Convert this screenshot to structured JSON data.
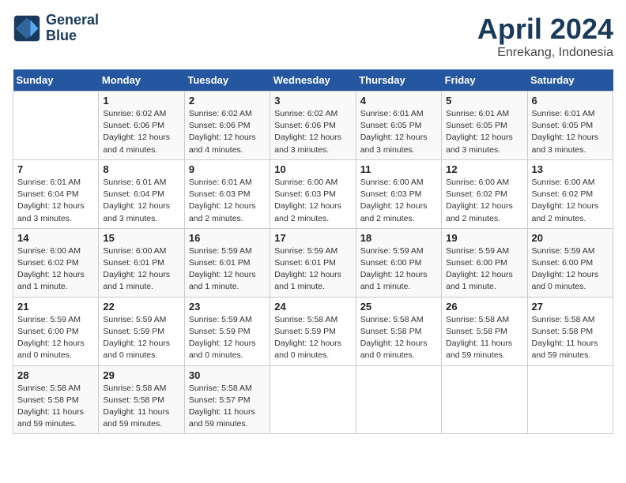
{
  "brand": {
    "line1": "General",
    "line2": "Blue"
  },
  "title": "April 2024",
  "location": "Enrekang, Indonesia",
  "days_of_week": [
    "Sunday",
    "Monday",
    "Tuesday",
    "Wednesday",
    "Thursday",
    "Friday",
    "Saturday"
  ],
  "weeks": [
    [
      {
        "day": "",
        "info": ""
      },
      {
        "day": "1",
        "info": "Sunrise: 6:02 AM\nSunset: 6:06 PM\nDaylight: 12 hours\nand 4 minutes."
      },
      {
        "day": "2",
        "info": "Sunrise: 6:02 AM\nSunset: 6:06 PM\nDaylight: 12 hours\nand 4 minutes."
      },
      {
        "day": "3",
        "info": "Sunrise: 6:02 AM\nSunset: 6:06 PM\nDaylight: 12 hours\nand 3 minutes."
      },
      {
        "day": "4",
        "info": "Sunrise: 6:01 AM\nSunset: 6:05 PM\nDaylight: 12 hours\nand 3 minutes."
      },
      {
        "day": "5",
        "info": "Sunrise: 6:01 AM\nSunset: 6:05 PM\nDaylight: 12 hours\nand 3 minutes."
      },
      {
        "day": "6",
        "info": "Sunrise: 6:01 AM\nSunset: 6:05 PM\nDaylight: 12 hours\nand 3 minutes."
      }
    ],
    [
      {
        "day": "7",
        "info": "Sunrise: 6:01 AM\nSunset: 6:04 PM\nDaylight: 12 hours\nand 3 minutes."
      },
      {
        "day": "8",
        "info": "Sunrise: 6:01 AM\nSunset: 6:04 PM\nDaylight: 12 hours\nand 3 minutes."
      },
      {
        "day": "9",
        "info": "Sunrise: 6:01 AM\nSunset: 6:03 PM\nDaylight: 12 hours\nand 2 minutes."
      },
      {
        "day": "10",
        "info": "Sunrise: 6:00 AM\nSunset: 6:03 PM\nDaylight: 12 hours\nand 2 minutes."
      },
      {
        "day": "11",
        "info": "Sunrise: 6:00 AM\nSunset: 6:03 PM\nDaylight: 12 hours\nand 2 minutes."
      },
      {
        "day": "12",
        "info": "Sunrise: 6:00 AM\nSunset: 6:02 PM\nDaylight: 12 hours\nand 2 minutes."
      },
      {
        "day": "13",
        "info": "Sunrise: 6:00 AM\nSunset: 6:02 PM\nDaylight: 12 hours\nand 2 minutes."
      }
    ],
    [
      {
        "day": "14",
        "info": "Sunrise: 6:00 AM\nSunset: 6:02 PM\nDaylight: 12 hours\nand 1 minute."
      },
      {
        "day": "15",
        "info": "Sunrise: 6:00 AM\nSunset: 6:01 PM\nDaylight: 12 hours\nand 1 minute."
      },
      {
        "day": "16",
        "info": "Sunrise: 5:59 AM\nSunset: 6:01 PM\nDaylight: 12 hours\nand 1 minute."
      },
      {
        "day": "17",
        "info": "Sunrise: 5:59 AM\nSunset: 6:01 PM\nDaylight: 12 hours\nand 1 minute."
      },
      {
        "day": "18",
        "info": "Sunrise: 5:59 AM\nSunset: 6:00 PM\nDaylight: 12 hours\nand 1 minute."
      },
      {
        "day": "19",
        "info": "Sunrise: 5:59 AM\nSunset: 6:00 PM\nDaylight: 12 hours\nand 1 minute."
      },
      {
        "day": "20",
        "info": "Sunrise: 5:59 AM\nSunset: 6:00 PM\nDaylight: 12 hours\nand 0 minutes."
      }
    ],
    [
      {
        "day": "21",
        "info": "Sunrise: 5:59 AM\nSunset: 6:00 PM\nDaylight: 12 hours\nand 0 minutes."
      },
      {
        "day": "22",
        "info": "Sunrise: 5:59 AM\nSunset: 5:59 PM\nDaylight: 12 hours\nand 0 minutes."
      },
      {
        "day": "23",
        "info": "Sunrise: 5:59 AM\nSunset: 5:59 PM\nDaylight: 12 hours\nand 0 minutes."
      },
      {
        "day": "24",
        "info": "Sunrise: 5:58 AM\nSunset: 5:59 PM\nDaylight: 12 hours\nand 0 minutes."
      },
      {
        "day": "25",
        "info": "Sunrise: 5:58 AM\nSunset: 5:58 PM\nDaylight: 12 hours\nand 0 minutes."
      },
      {
        "day": "26",
        "info": "Sunrise: 5:58 AM\nSunset: 5:58 PM\nDaylight: 11 hours\nand 59 minutes."
      },
      {
        "day": "27",
        "info": "Sunrise: 5:58 AM\nSunset: 5:58 PM\nDaylight: 11 hours\nand 59 minutes."
      }
    ],
    [
      {
        "day": "28",
        "info": "Sunrise: 5:58 AM\nSunset: 5:58 PM\nDaylight: 11 hours\nand 59 minutes."
      },
      {
        "day": "29",
        "info": "Sunrise: 5:58 AM\nSunset: 5:58 PM\nDaylight: 11 hours\nand 59 minutes."
      },
      {
        "day": "30",
        "info": "Sunrise: 5:58 AM\nSunset: 5:57 PM\nDaylight: 11 hours\nand 59 minutes."
      },
      {
        "day": "",
        "info": ""
      },
      {
        "day": "",
        "info": ""
      },
      {
        "day": "",
        "info": ""
      },
      {
        "day": "",
        "info": ""
      }
    ]
  ]
}
